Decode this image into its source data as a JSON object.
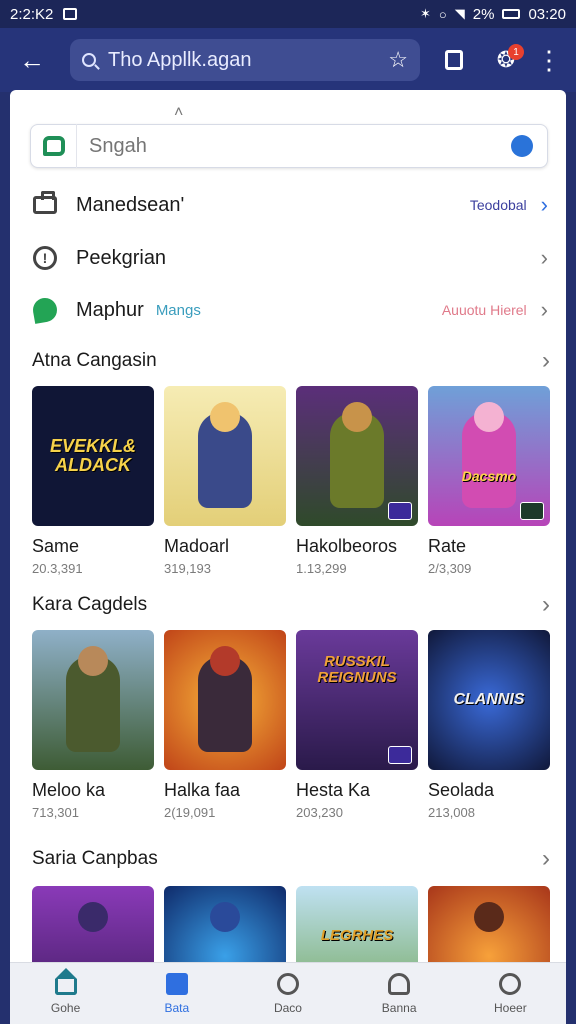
{
  "status_bar": {
    "time": "2:2:K2",
    "battery_text": "2%",
    "clock_right": "03:20"
  },
  "app_bar": {
    "url": "Tho Appllk.agan",
    "badge": "1"
  },
  "search": {
    "placeholder": "Sngah"
  },
  "settings": [
    {
      "label": "Manedsean'",
      "sub": "",
      "value": "Teodobal",
      "value_color": "#3b3f9e",
      "icon": "briefcase-icon"
    },
    {
      "label": "Peekgrian",
      "sub": "",
      "value": "",
      "value_color": "",
      "icon": "info-icon"
    },
    {
      "label": "Maphur",
      "sub": "Mangs",
      "value": "Auuotu Hierel",
      "value_color": "#e07a8a",
      "icon": "leaf-icon"
    }
  ],
  "sections": [
    {
      "title": "Atna Cangasin",
      "cards": [
        {
          "title": "Same",
          "count": "20.3,391",
          "art_text": "EVEKKL& ALDACK",
          "bg": "#101636"
        },
        {
          "title": "Madoarl",
          "count": "319,193",
          "art_text": "",
          "bg": "#f1e3a2"
        },
        {
          "title": "Hakolbeoros",
          "count": "1.13,299",
          "art_text": "",
          "bg": "#314a2b"
        },
        {
          "title": "Rate",
          "count": "2/3,309",
          "art_text": "Dacsmo",
          "bg": "#a545b8"
        }
      ]
    },
    {
      "title": "Kara Cagdels",
      "cards": [
        {
          "title": "Meloo ka",
          "count": "713,301",
          "art_text": "",
          "bg": "#4a6d52"
        },
        {
          "title": "Halka faa",
          "count": "2(19,091",
          "art_text": "",
          "bg": "#d36a22"
        },
        {
          "title": "Hesta Ka",
          "count": "203,230",
          "art_text": "RUSSKIL REIGNUNS",
          "bg": "#4a2a6e"
        },
        {
          "title": "Seolada",
          "count": "213,008",
          "art_text": "CLANNIS",
          "bg": "#1a2c5c"
        }
      ]
    },
    {
      "title": "Saria Canpbas",
      "cards": [
        {
          "title": "",
          "count": "",
          "art_text": "",
          "bg": "#6a2a8e"
        },
        {
          "title": "",
          "count": "",
          "art_text": "",
          "bg": "#16367e"
        },
        {
          "title": "",
          "count": "",
          "art_text": "LEGRHES",
          "bg": "#5ea0c8"
        },
        {
          "title": "",
          "count": "",
          "art_text": "",
          "bg": "#d2561e"
        }
      ]
    }
  ],
  "bottom_nav": [
    {
      "label": "Gohe",
      "icon": "home-icon"
    },
    {
      "label": "Bata",
      "icon": "apps-icon"
    },
    {
      "label": "Daco",
      "icon": "games-icon"
    },
    {
      "label": "Banna",
      "icon": "person-icon"
    },
    {
      "label": "Hoeer",
      "icon": "search-icon"
    }
  ]
}
